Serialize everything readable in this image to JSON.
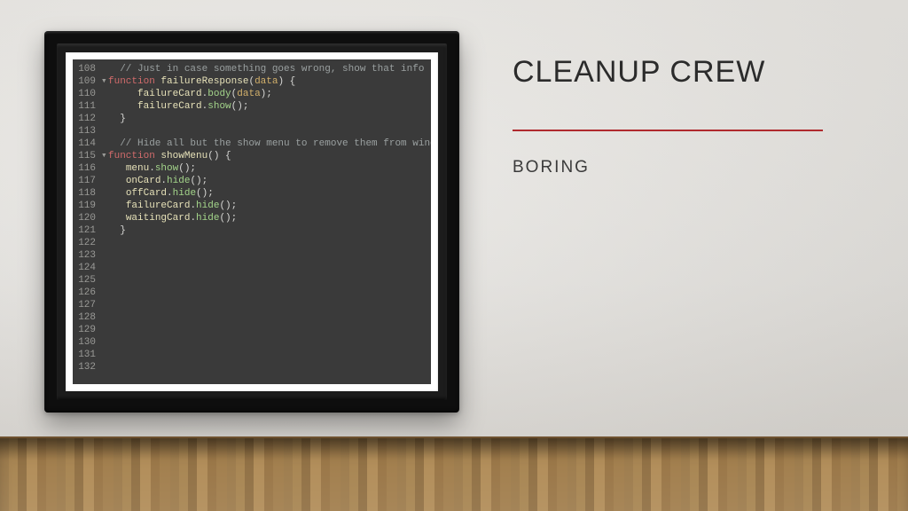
{
  "title": "CLEANUP CREW",
  "subtitle": "BORING",
  "code": {
    "lines": [
      {
        "n": 108,
        "fold": "",
        "tokens": [
          {
            "t": "  ",
            "c": ""
          },
          {
            "t": "// Just in case something goes wrong, show that info",
            "c": "comment"
          }
        ]
      },
      {
        "n": 109,
        "fold": "▾",
        "tokens": [
          {
            "t": "function ",
            "c": "keyword"
          },
          {
            "t": "failureResponse",
            "c": "fn"
          },
          {
            "t": "(",
            "c": "punct"
          },
          {
            "t": "data",
            "c": "param"
          },
          {
            "t": ") {",
            "c": "punct"
          }
        ]
      },
      {
        "n": 110,
        "fold": "",
        "tokens": [
          {
            "t": "     ",
            "c": ""
          },
          {
            "t": "failureCard",
            "c": "ident"
          },
          {
            "t": ".",
            "c": "punct"
          },
          {
            "t": "body",
            "c": "method"
          },
          {
            "t": "(",
            "c": "punct"
          },
          {
            "t": "data",
            "c": "param"
          },
          {
            "t": ");",
            "c": "punct"
          }
        ]
      },
      {
        "n": 111,
        "fold": "",
        "tokens": [
          {
            "t": "     ",
            "c": ""
          },
          {
            "t": "failureCard",
            "c": "ident"
          },
          {
            "t": ".",
            "c": "punct"
          },
          {
            "t": "show",
            "c": "method"
          },
          {
            "t": "();",
            "c": "punct"
          }
        ]
      },
      {
        "n": 112,
        "fold": "",
        "tokens": [
          {
            "t": "  }",
            "c": "punct"
          }
        ]
      },
      {
        "n": 113,
        "fold": "",
        "tokens": []
      },
      {
        "n": 114,
        "fold": "",
        "tokens": [
          {
            "t": "  ",
            "c": ""
          },
          {
            "t": "// Hide all but the show menu to remove them from window stack frame",
            "c": "comment"
          }
        ]
      },
      {
        "n": 115,
        "fold": "▾",
        "tokens": [
          {
            "t": "function ",
            "c": "keyword"
          },
          {
            "t": "showMenu",
            "c": "fn"
          },
          {
            "t": "() {",
            "c": "punct"
          }
        ]
      },
      {
        "n": 116,
        "fold": "",
        "tokens": [
          {
            "t": "   ",
            "c": ""
          },
          {
            "t": "menu",
            "c": "ident"
          },
          {
            "t": ".",
            "c": "punct"
          },
          {
            "t": "show",
            "c": "method"
          },
          {
            "t": "();",
            "c": "punct"
          }
        ]
      },
      {
        "n": 117,
        "fold": "",
        "tokens": [
          {
            "t": "   ",
            "c": ""
          },
          {
            "t": "onCard",
            "c": "ident"
          },
          {
            "t": ".",
            "c": "punct"
          },
          {
            "t": "hide",
            "c": "method"
          },
          {
            "t": "();",
            "c": "punct"
          }
        ]
      },
      {
        "n": 118,
        "fold": "",
        "tokens": [
          {
            "t": "   ",
            "c": ""
          },
          {
            "t": "offCard",
            "c": "ident"
          },
          {
            "t": ".",
            "c": "punct"
          },
          {
            "t": "hide",
            "c": "method"
          },
          {
            "t": "();",
            "c": "punct"
          }
        ]
      },
      {
        "n": 119,
        "fold": "",
        "tokens": [
          {
            "t": "   ",
            "c": ""
          },
          {
            "t": "failureCard",
            "c": "ident"
          },
          {
            "t": ".",
            "c": "punct"
          },
          {
            "t": "hide",
            "c": "method"
          },
          {
            "t": "();",
            "c": "punct"
          }
        ]
      },
      {
        "n": 120,
        "fold": "",
        "tokens": [
          {
            "t": "   ",
            "c": ""
          },
          {
            "t": "waitingCard",
            "c": "ident"
          },
          {
            "t": ".",
            "c": "punct"
          },
          {
            "t": "hide",
            "c": "method"
          },
          {
            "t": "();",
            "c": "punct"
          }
        ]
      },
      {
        "n": 121,
        "fold": "",
        "tokens": [
          {
            "t": "  }",
            "c": "punct"
          }
        ]
      },
      {
        "n": 122,
        "fold": "",
        "tokens": []
      },
      {
        "n": 123,
        "fold": "",
        "tokens": []
      },
      {
        "n": 124,
        "fold": "",
        "tokens": []
      },
      {
        "n": 125,
        "fold": "",
        "tokens": []
      },
      {
        "n": 126,
        "fold": "",
        "tokens": []
      },
      {
        "n": 127,
        "fold": "",
        "tokens": []
      },
      {
        "n": 128,
        "fold": "",
        "tokens": []
      },
      {
        "n": 129,
        "fold": "",
        "tokens": []
      },
      {
        "n": 130,
        "fold": "",
        "tokens": []
      },
      {
        "n": 131,
        "fold": "",
        "tokens": []
      },
      {
        "n": 132,
        "fold": "",
        "tokens": []
      }
    ]
  }
}
